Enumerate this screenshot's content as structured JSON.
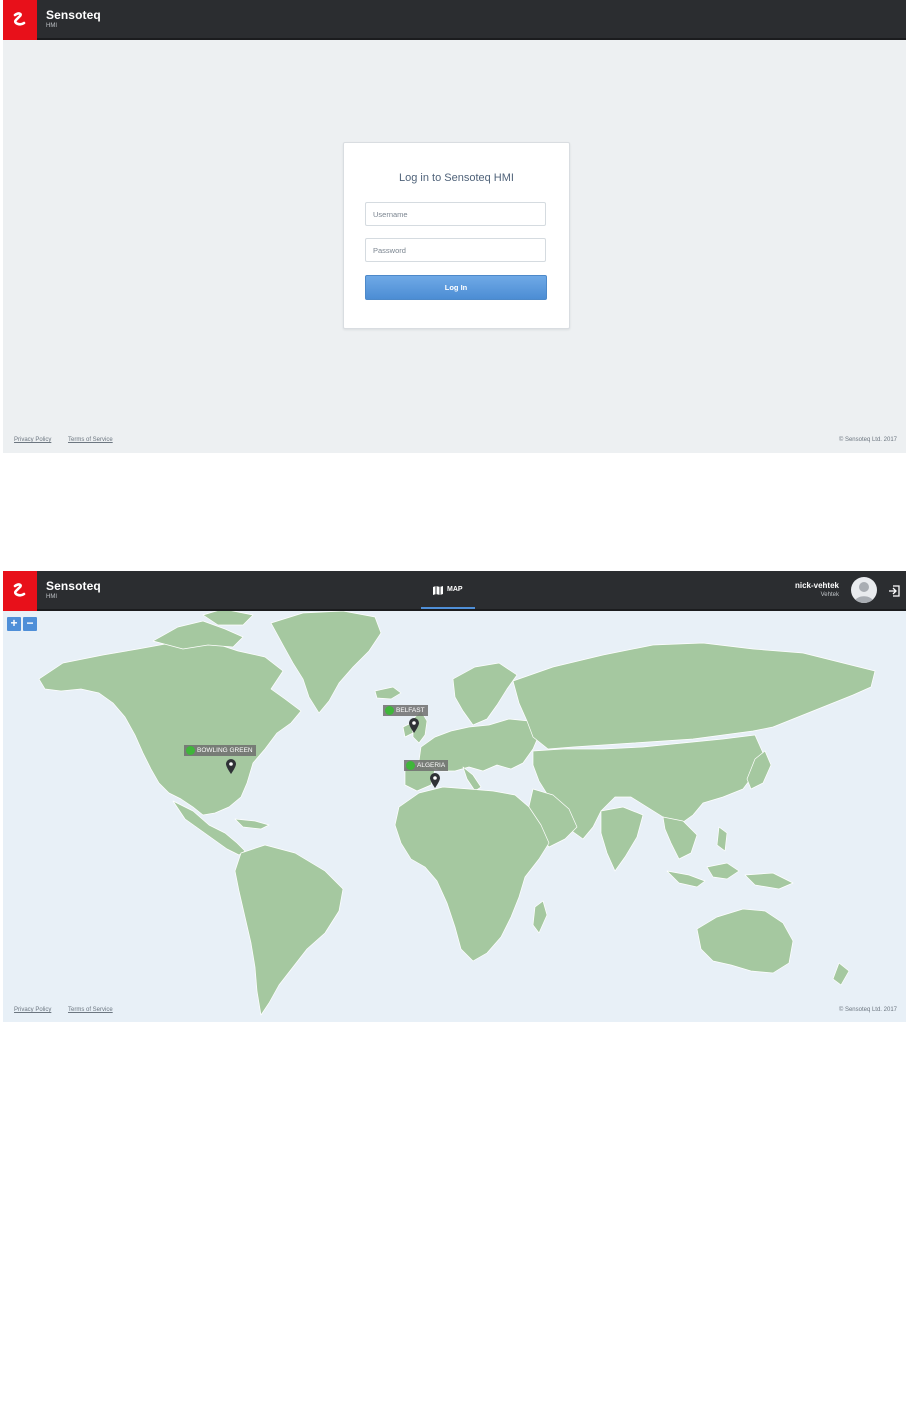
{
  "brand": {
    "name": "Sensoteq",
    "sub": "HMI"
  },
  "colors": {
    "brand_red": "#e8101a",
    "topbar": "#2b2d30",
    "accent": "#4f8fd8",
    "land": "#a5c8a0",
    "water": "#e8f0f7",
    "status_ok": "#3fb63a"
  },
  "login": {
    "title": "Log in to Sensoteq HMI",
    "username_placeholder": "Username",
    "password_placeholder": "Password",
    "login_button": "Log In"
  },
  "footer": {
    "privacy": "Privacy Policy",
    "terms": "Terms of Service",
    "copyright": "© Sensoteq Ltd. 2017"
  },
  "nav": {
    "map_tab": "MAP"
  },
  "user": {
    "name": "nick-vehtek",
    "org": "Vehtek"
  },
  "zoom": {
    "in": "+",
    "out": "−"
  },
  "map_sites": [
    {
      "label": "BELFAST",
      "status": "ok"
    },
    {
      "label": "BOWLING GREEN",
      "status": "ok"
    },
    {
      "label": "ALGERIA",
      "status": "ok"
    }
  ],
  "icons": {
    "logo": "sensoteq-logo-icon",
    "map": "map-icon",
    "logout": "logout-icon",
    "avatar": "user-avatar-icon",
    "pin": "map-pin-icon",
    "ok": "check-circle-icon"
  }
}
